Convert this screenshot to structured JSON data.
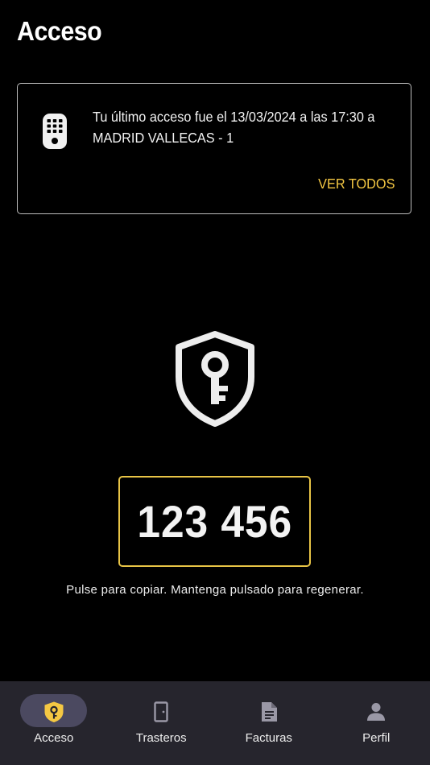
{
  "page": {
    "title": "Acceso"
  },
  "last_access": {
    "text": "Tu último acceso fue el 13/03/2024 a las 17:30 a MADRID VALLECAS - 1",
    "see_all_label": "VER TODOS",
    "icon": "keypad-icon"
  },
  "code": {
    "icon": "shield-key-icon",
    "value": "123 456",
    "hint": "Pulse para copiar. Mantenga pulsado para regenerar."
  },
  "bottom_nav": {
    "items": [
      {
        "label": "Acceso",
        "icon": "shield-key-icon",
        "active": true
      },
      {
        "label": "Trasteros",
        "icon": "door-icon",
        "active": false
      },
      {
        "label": "Facturas",
        "icon": "document-icon",
        "active": false
      },
      {
        "label": "Perfil",
        "icon": "person-icon",
        "active": false
      }
    ]
  },
  "colors": {
    "background": "#000000",
    "accent": "#F5C843",
    "nav_background": "#26252D",
    "nav_active_pill": "#4B4960"
  }
}
